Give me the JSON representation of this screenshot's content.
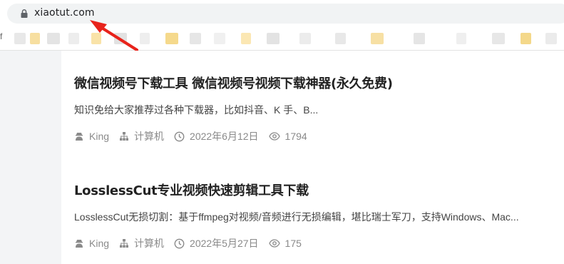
{
  "browser": {
    "url": "xiaotut.com",
    "bookmarks_left_glyph": "f",
    "blur_colors": [
      "#e8e8e8",
      "#f7dfa0",
      "#e4e4e4",
      "#ededed",
      "#f9e3a8",
      "#e2e2e2",
      "#eeeeee",
      "#f5d98c",
      "#e6e6e6",
      "#f0f0f0",
      "#fbe7b3",
      "#e3e3e3",
      "#ececec",
      "#e8e8e8",
      "#f7e0a4",
      "#e5e5e5",
      "#efefef",
      "#e7e7e7",
      "#f4d88a",
      "#ebebeb"
    ],
    "annotation_color": "#e8231b"
  },
  "articles": [
    {
      "title": "微信视频号下载工具 微信视频号视频下载神器(永久免费)",
      "excerpt": "知识免给大家推荐过各种下载器，比如抖音、K 手、B...",
      "author": "King",
      "category": "计算机",
      "date": "2022年6月12日",
      "views": "1794"
    },
    {
      "title": "LosslessCut专业视频快速剪辑工具下载",
      "excerpt": "LosslessCut无损切割：基于ffmpeg对视频/音频进行无损编辑，堪比瑞士军刀，支持Windows、Mac...",
      "author": "King",
      "category": "计算机",
      "date": "2022年5月27日",
      "views": "175"
    }
  ]
}
